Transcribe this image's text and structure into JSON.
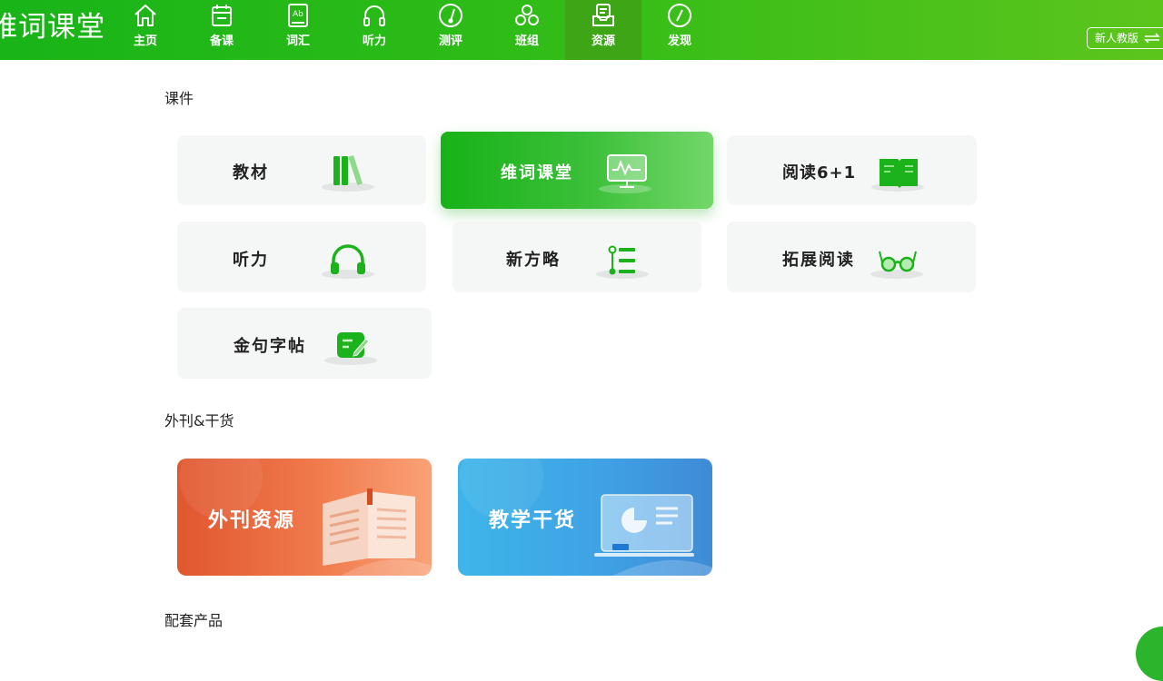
{
  "app": {
    "logo_text": "维词课堂"
  },
  "nav": {
    "items": [
      {
        "label": "主页",
        "icon": "home-icon"
      },
      {
        "label": "备课",
        "icon": "calendar-icon"
      },
      {
        "label": "词汇",
        "icon": "book-ab-icon"
      },
      {
        "label": "听力",
        "icon": "headphones-icon"
      },
      {
        "label": "测评",
        "icon": "gauge-icon"
      },
      {
        "label": "班组",
        "icon": "group-icon"
      },
      {
        "label": "资源",
        "icon": "inbox-icon",
        "active": true
      },
      {
        "label": "发现",
        "icon": "compass-icon"
      }
    ],
    "switch_label": "新人教版"
  },
  "sections": {
    "courseware": "课件",
    "magazines": "外刊&干货",
    "products": "配套产品"
  },
  "courseware_cards": [
    {
      "label": "教材",
      "icon": "books-icon"
    },
    {
      "label": "维词课堂",
      "icon": "monitor-icon",
      "featured": true
    },
    {
      "label": "阅读6+1",
      "icon": "open-book-icon"
    },
    {
      "label": "听力",
      "icon": "headphones-icon"
    },
    {
      "label": "新方略",
      "icon": "list-icon"
    },
    {
      "label": "拓展阅读",
      "icon": "glasses-icon"
    },
    {
      "label": "金句字帖",
      "icon": "notepad-pen-icon"
    }
  ],
  "magazine_cards": [
    {
      "label": "外刊资源",
      "icon": "magazine-icon"
    },
    {
      "label": "教学干货",
      "icon": "chart-board-icon"
    }
  ],
  "colors": {
    "brand_green": "#1db31b",
    "card_bg": "#f5f6f6",
    "icon_green": "#1cb21c",
    "orange_card": "#e5663a",
    "blue_card": "#3aa6e6"
  }
}
